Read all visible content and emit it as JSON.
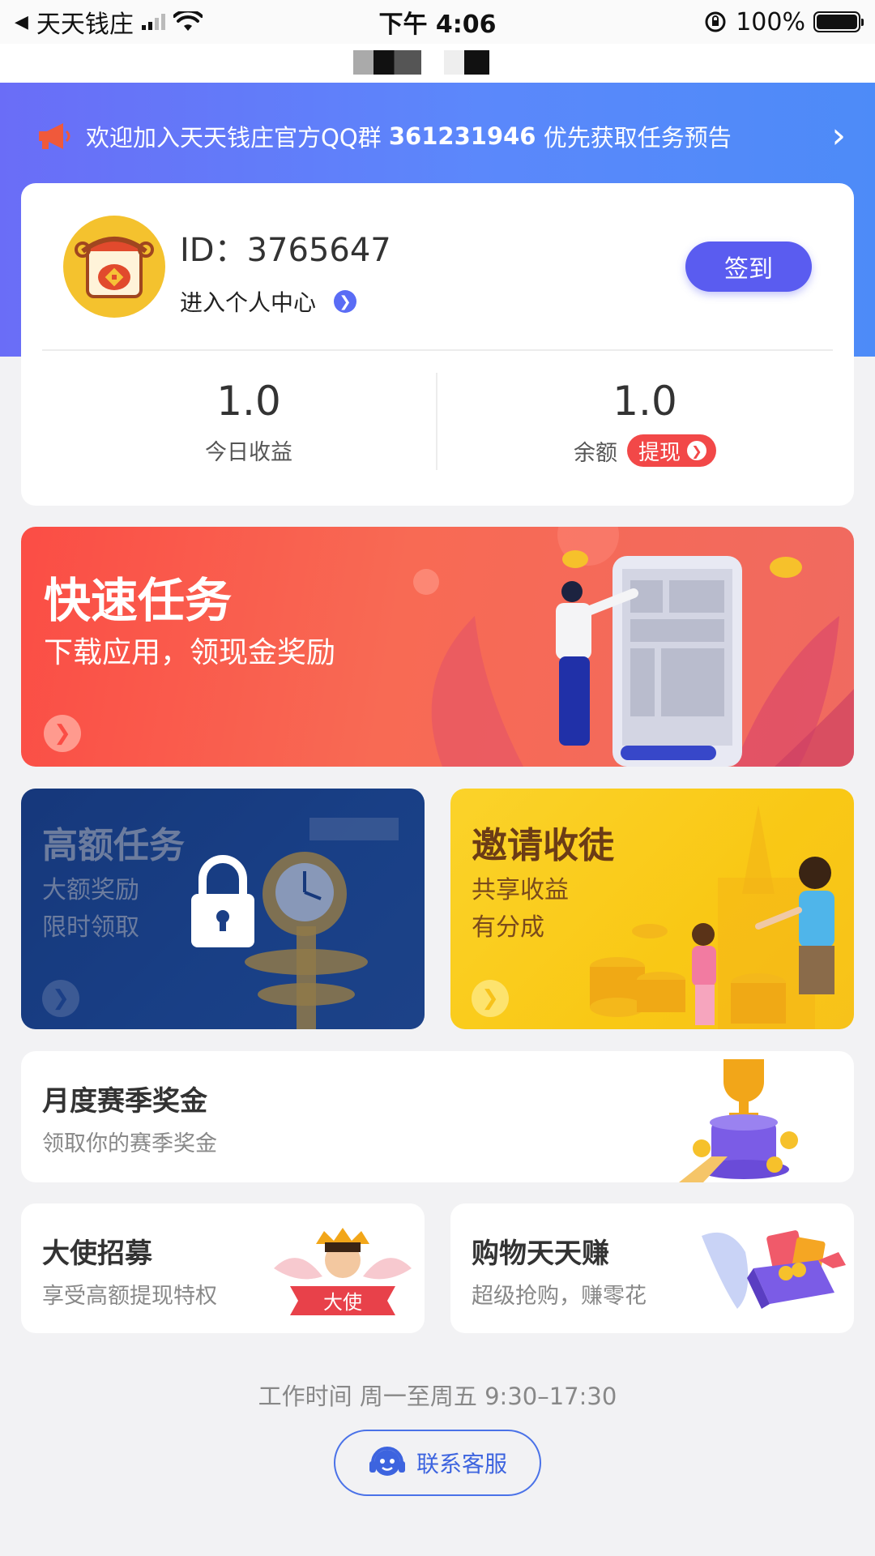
{
  "status_bar": {
    "back_app": "天天钱庄",
    "time": "下午 4:06",
    "battery": "100%"
  },
  "notice": {
    "text_prefix": "欢迎加入天天钱庄官方QQ群 ",
    "group_number": "361231946",
    "text_suffix": " 优先获取任务预告"
  },
  "user": {
    "id_label": "ID：",
    "id_value": "3765647",
    "enter_center": "进入个人中心",
    "signin_label": "签到"
  },
  "stats": {
    "today_income_value": "1.0",
    "today_income_label": "今日收益",
    "balance_value": "1.0",
    "balance_label": "余额",
    "withdraw_label": "提现"
  },
  "quick_task": {
    "title": "快速任务",
    "subtitle": "下载应用，领现金奖励"
  },
  "big_task": {
    "title": "高额任务",
    "line1": "大额奖励",
    "line2": "限时领取",
    "locked": true
  },
  "invite": {
    "title": "邀请收徒",
    "line1": "共享收益",
    "line2": "有分成"
  },
  "season": {
    "title": "月度赛季奖金",
    "subtitle": "领取你的赛季奖金"
  },
  "ambassador": {
    "title": "大使招募",
    "subtitle": "享受高额提现特权",
    "badge": "大使"
  },
  "shopping": {
    "title": "购物天天赚",
    "subtitle": "超级抢购，赚零花"
  },
  "footer": {
    "work_time": "工作时间 周一至周五 9:30–17:30",
    "service_label": "联系客服"
  },
  "colors": {
    "header_blue": "#5b88fb",
    "signin_purple": "#5a5cf0",
    "withdraw_red": "#f24848",
    "quick_red": "#fb4d45",
    "big_task_navy": "#1f4b97",
    "invite_yellow": "#f9c815",
    "service_blue": "#3d64df"
  }
}
